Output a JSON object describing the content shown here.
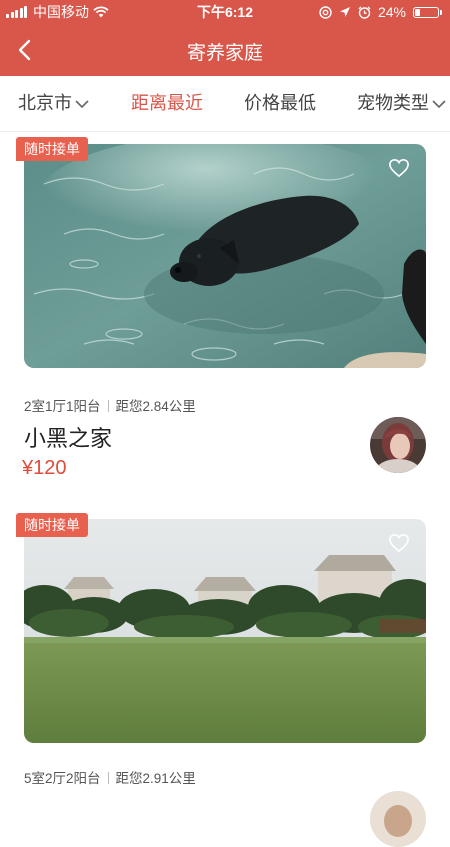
{
  "status_bar": {
    "carrier": "中国移动",
    "time": "下午6:12",
    "battery": "24%",
    "battery_level": 0.24,
    "icons": [
      "signal-icon",
      "wifi-icon",
      "at-icon",
      "location-icon",
      "alarm-icon",
      "battery-icon"
    ]
  },
  "nav": {
    "title": "寄养家庭",
    "back_icon": "back-arrow-icon"
  },
  "filters": [
    {
      "label": "北京市",
      "has_dropdown": true,
      "active": false
    },
    {
      "label": "距离最近",
      "has_dropdown": false,
      "active": true
    },
    {
      "label": "价格最低",
      "has_dropdown": false,
      "active": false
    },
    {
      "label": "宠物类型",
      "has_dropdown": true,
      "active": false
    }
  ],
  "listings": [
    {
      "badge": "随时接单",
      "layout": "2室1厅1阳台",
      "distance": "距您2.84公里",
      "name": "小黑之家",
      "price": "¥120",
      "photo": "black-dog-swimming-photo"
    },
    {
      "badge": "随时接单",
      "layout": "5室2厅2阳台",
      "distance": "距您2.91公里",
      "name": "",
      "price": "",
      "photo": "lawn-park-photo"
    }
  ],
  "colors": {
    "accent": "#d9564a",
    "price": "#e04b3a",
    "badge": "#e8604e"
  }
}
